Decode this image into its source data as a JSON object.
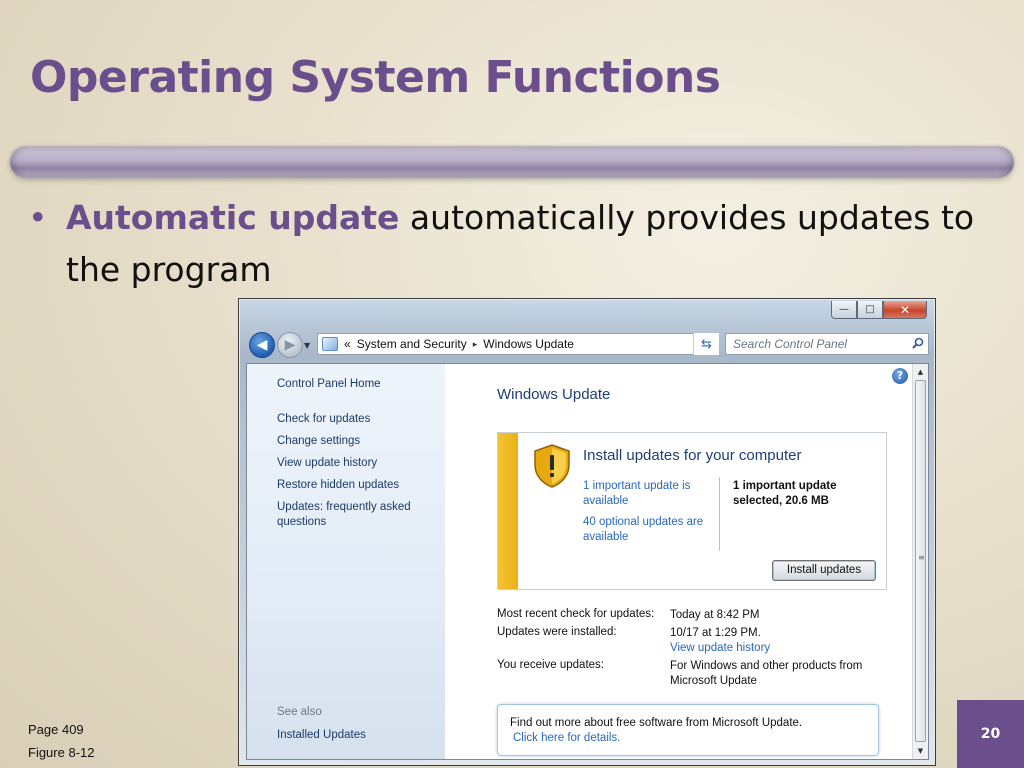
{
  "slide": {
    "title": "Operating System Functions",
    "bullet": {
      "marker": "•",
      "term": "Automatic update",
      "text": " automatically provides updates to the program"
    },
    "footer": {
      "page_ref": "Page 409",
      "figure_ref": "Figure 8-12",
      "slide_number": "20"
    },
    "colors": {
      "accent": "#6b4e8c"
    }
  },
  "window": {
    "controls": {
      "minimize": "—",
      "maximize": "□",
      "close": "✕"
    },
    "nav": {
      "back_icon": "back-arrow-icon",
      "forward_icon": "forward-arrow-icon",
      "breadcrumb_prefix": "«",
      "breadcrumb": [
        "System and Security",
        "Windows Update"
      ],
      "breadcrumb_separator": "▸",
      "search_placeholder": "Search Control Panel"
    },
    "sidebar": {
      "home": "Control Panel Home",
      "items": [
        "Check for updates",
        "Change settings",
        "View update history",
        "Restore hidden updates",
        "Updates: frequently asked questions"
      ],
      "see_also_label": "See also",
      "see_also_items": [
        "Installed Updates"
      ]
    },
    "main": {
      "help_glyph": "?",
      "title": "Windows Update",
      "panel": {
        "heading": "Install updates for your computer",
        "important_link": "1 important update is available",
        "optional_link": "40 optional updates are available",
        "selected_summary": "1 important update selected, 20.6 MB",
        "install_button": "Install updates"
      },
      "info": [
        {
          "label": "Most recent check for updates:",
          "value": "Today at 8:42 PM"
        },
        {
          "label": "Updates were installed:",
          "value": "10/17 at 1:29 PM.",
          "link": "View update history"
        },
        {
          "label": "You receive updates:",
          "value": "For Windows and other products from Microsoft Update"
        }
      ],
      "notice": {
        "text": "Find out more about free software from Microsoft Update.",
        "link": "Click here for details."
      }
    }
  }
}
